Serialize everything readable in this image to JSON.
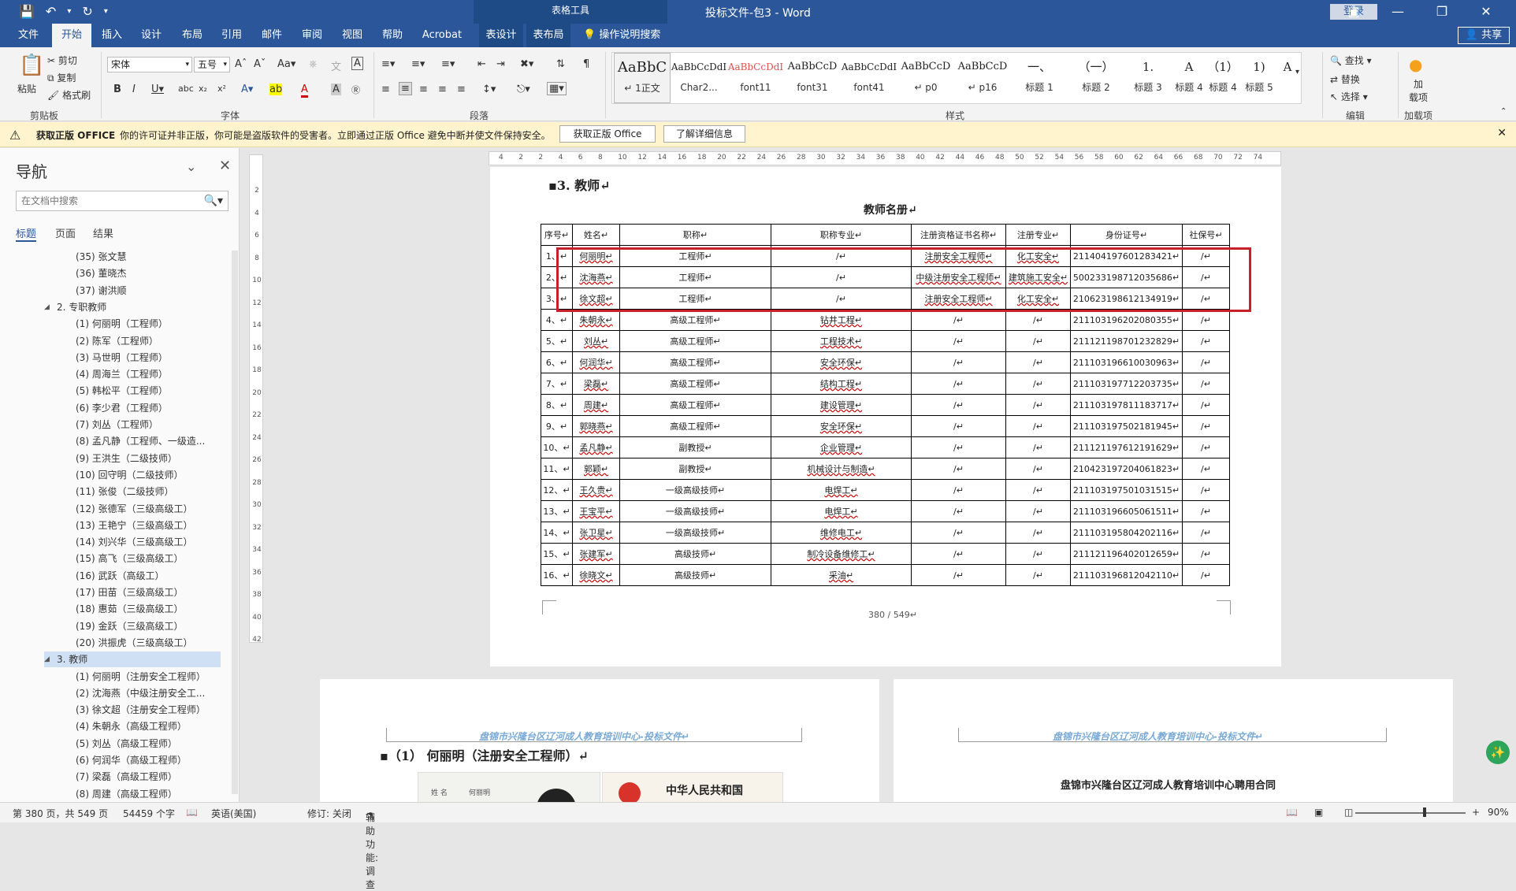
{
  "app": {
    "window_title": "投标文件-包3 - Word",
    "contextual_tab_group": "表格工具",
    "login_label": "登录",
    "share_label": "共享"
  },
  "qat": {
    "save_icon": "save-icon",
    "undo_icon": "undo-icon",
    "redo_icon": "redo-icon",
    "customize_icon": "chevron-down-icon"
  },
  "tabs": [
    {
      "label": "文件"
    },
    {
      "label": "开始"
    },
    {
      "label": "插入"
    },
    {
      "label": "设计"
    },
    {
      "label": "布局"
    },
    {
      "label": "引用"
    },
    {
      "label": "邮件"
    },
    {
      "label": "审阅"
    },
    {
      "label": "视图"
    },
    {
      "label": "帮助"
    },
    {
      "label": "Acrobat"
    },
    {
      "label": "表设计"
    },
    {
      "label": "表布局"
    }
  ],
  "tell_me": "操作说明搜索",
  "ribbon": {
    "clipboard": {
      "paste": "粘贴",
      "cut": "剪切",
      "copy": "复制",
      "format_painter": "格式刷",
      "group_label": "剪贴板"
    },
    "font": {
      "font_name": "宋体",
      "font_size": "五号",
      "group_label": "字体"
    },
    "paragraph": {
      "group_label": "段落"
    },
    "styles": {
      "group_label": "样式",
      "items": [
        {
          "sample": "AaBbC",
          "name": "↵ 1正文"
        },
        {
          "sample": "AaBbCcDdI",
          "name": "Char2..."
        },
        {
          "sample": "AaBbCcDdI",
          "name": "font11"
        },
        {
          "sample": "AaBbCcD",
          "name": "font31"
        },
        {
          "sample": "AaBbCcDdI",
          "name": "font41"
        },
        {
          "sample": "AaBbCcD",
          "name": "↵ p0"
        },
        {
          "sample": "AaBbCcD",
          "name": "↵ p16"
        },
        {
          "sample": "一、",
          "name": "标题 1"
        },
        {
          "sample": "（一）",
          "name": "标题 2"
        },
        {
          "sample": "1.",
          "name": "标题 3"
        },
        {
          "sample": "A",
          "name": "标题 4"
        },
        {
          "sample": "（1）",
          "name": "标题 4"
        },
        {
          "sample": "1)",
          "name": "标题 5"
        },
        {
          "sample": "A",
          "name": ""
        }
      ]
    },
    "editing": {
      "find": "查找",
      "replace": "替换",
      "select": "选择",
      "group_label": "编辑"
    },
    "addins": {
      "label": "加载项",
      "button": "加\n载项"
    }
  },
  "message_bar": {
    "title": "获取正版 OFFICE",
    "text": "你的许可证并非正版，你可能是盗版软件的受害者。立即通过正版 Office 避免中断并使文件保持安全。",
    "btn_genuine": "获取正版 Office",
    "btn_learn": "了解详细信息"
  },
  "nav": {
    "title": "导航",
    "search_placeholder": "在文档中搜索",
    "tabs": [
      "标题",
      "页面",
      "结果"
    ],
    "items": [
      {
        "text": "(35)  张文慧",
        "level": 3
      },
      {
        "text": "(36)  董晓杰",
        "level": 3
      },
      {
        "text": "(37)  谢洪顺",
        "level": 3
      },
      {
        "text": "2. 专职教师",
        "level": 2
      },
      {
        "text": "(1)  何丽明（工程师）",
        "level": 3
      },
      {
        "text": "(2)  陈军（工程师）",
        "level": 3
      },
      {
        "text": "(3)  马世明（工程师）",
        "level": 3
      },
      {
        "text": "(4)  周海兰（工程师）",
        "level": 3
      },
      {
        "text": "(5)  韩松平（工程师）",
        "level": 3
      },
      {
        "text": "(6)  李少君（工程师）",
        "level": 3
      },
      {
        "text": "(7)  刘丛（工程师）",
        "level": 3
      },
      {
        "text": "(8)  孟凡静（工程师、一级造...",
        "level": 3
      },
      {
        "text": "(9)  王洪生（二级技师）",
        "level": 3
      },
      {
        "text": "(10)  回守明（二级技师）",
        "level": 3
      },
      {
        "text": "(11)  张俊（二级技师）",
        "level": 3
      },
      {
        "text": "(12)  张德军（三级高级工）",
        "level": 3
      },
      {
        "text": "(13)  王艳宁（三级高级工）",
        "level": 3
      },
      {
        "text": "(14)  刘兴华（三级高级工）",
        "level": 3
      },
      {
        "text": "(15)  高飞（三级高级工）",
        "level": 3
      },
      {
        "text": "(16)  武跃（高级工）",
        "level": 3
      },
      {
        "text": "(17)  田苗（三级高级工）",
        "level": 3
      },
      {
        "text": "(18)  惠茹（三级高级工）",
        "level": 3
      },
      {
        "text": "(19)  金跃（三级高级工）",
        "level": 3
      },
      {
        "text": "(20)  洪振虎（三级高级工）",
        "level": 3
      },
      {
        "text": "3. 教师",
        "level": 2
      },
      {
        "text": "(1)  何丽明（注册安全工程师）",
        "level": 3
      },
      {
        "text": "(2)  沈海燕（中级注册安全工...",
        "level": 3
      },
      {
        "text": "(3)  徐文超（注册安全工程师）",
        "level": 3
      },
      {
        "text": "(4)  朱朝永（高级工程师）",
        "level": 3
      },
      {
        "text": "(5)  刘丛（高级工程师）",
        "level": 3
      },
      {
        "text": "(6)  何润华（高级工程师）",
        "level": 3
      },
      {
        "text": "(7)  梁磊（高级工程师）",
        "level": 3
      },
      {
        "text": "(8)  周建（高级工程师）",
        "level": 3
      }
    ]
  },
  "ruler": {
    "h_ticks": [
      "4",
      "2",
      "2",
      "4",
      "6",
      "8",
      "10",
      "12",
      "14",
      "16",
      "18",
      "20",
      "22",
      "24",
      "26",
      "28",
      "30",
      "32",
      "34",
      "36",
      "38",
      "40",
      "42",
      "44",
      "46",
      "48",
      "50",
      "52",
      "54",
      "56",
      "58",
      "60",
      "62",
      "64",
      "66",
      "68",
      "70",
      "72",
      "74"
    ],
    "v_ticks": [
      "2",
      "4",
      "6",
      "8",
      "10",
      "12",
      "14",
      "16",
      "18",
      "20",
      "22",
      "24",
      "26",
      "28",
      "30",
      "32",
      "34",
      "36",
      "38",
      "40",
      "42"
    ]
  },
  "document": {
    "section_heading": "▪3.  教师↵",
    "table_caption": "教师名册↵",
    "columns": [
      "序号↵",
      "姓名↵",
      "职称↵",
      "职称专业↵",
      "注册资格证书名称↵",
      "注册专业↵",
      "身份证号↵",
      "社保号↵"
    ],
    "rows": [
      [
        "1、↵",
        "何丽明↵",
        "工程师↵",
        "/↵",
        "注册安全工程师↵",
        "化工安全↵",
        "211404197601283421↵",
        "/↵"
      ],
      [
        "2、↵",
        "沈海燕↵",
        "工程师↵",
        "/↵",
        "中级注册安全工程师↵",
        "建筑施工安全↵",
        "500233198712035686↵",
        "/↵"
      ],
      [
        "3、↵",
        "徐文超↵",
        "工程师↵",
        "/↵",
        "注册安全工程师↵",
        "化工安全↵",
        "210623198612134919↵",
        "/↵"
      ],
      [
        "4、↵",
        "朱朝永↵",
        "高级工程师↵",
        "钻井工程↵",
        "/↵",
        "/↵",
        "211103196202080355↵",
        "/↵"
      ],
      [
        "5、↵",
        "刘丛↵",
        "高级工程师↵",
        "工程技术↵",
        "/↵",
        "/↵",
        "211121198701232829↵",
        "/↵"
      ],
      [
        "6、↵",
        "何润华↵",
        "高级工程师↵",
        "安全环保↵",
        "/↵",
        "/↵",
        "211103196610030963↵",
        "/↵"
      ],
      [
        "7、↵",
        "梁磊↵",
        "高级工程师↵",
        "结构工程↵",
        "/↵",
        "/↵",
        "211103197712203735↵",
        "/↵"
      ],
      [
        "8、↵",
        "周建↵",
        "高级工程师↵",
        "建设管理↵",
        "/↵",
        "/↵",
        "211103197811183717↵",
        "/↵"
      ],
      [
        "9、↵",
        "郭晓燕↵",
        "高级工程师↵",
        "安全环保↵",
        "/↵",
        "/↵",
        "211103197502181945↵",
        "/↵"
      ],
      [
        "10、↵",
        "孟凡静↵",
        "副教授↵",
        "企业管理↵",
        "/↵",
        "/↵",
        "211121197612191629↵",
        "/↵"
      ],
      [
        "11、↵",
        "郭颖↵",
        "副教授↵",
        "机械设计与制造↵",
        "/↵",
        "/↵",
        "210423197204061823↵",
        "/↵"
      ],
      [
        "12、↵",
        "王久贵↵",
        "一级高级技师↵",
        "电焊工↵",
        "/↵",
        "/↵",
        "211103197501031515↵",
        "/↵"
      ],
      [
        "13、↵",
        "王宝平↵",
        "一级高级技师↵",
        "电焊工↵",
        "/↵",
        "/↵",
        "211103196605061511↵",
        "/↵"
      ],
      [
        "14、↵",
        "张卫星↵",
        "一级高级技师↵",
        "维修电工↵",
        "/↵",
        "/↵",
        "211103195804202116↵",
        "/↵"
      ],
      [
        "15、↵",
        "张建军↵",
        "高级技师↵",
        "制冷设备维修工↵",
        "/↵",
        "/↵",
        "211121196402012659↵",
        "/↵"
      ],
      [
        "16、↵",
        "徐晓文↵",
        "高级技师↵",
        "采油↵",
        "/↵",
        "/↵",
        "211103196812042110↵",
        "/↵"
      ]
    ],
    "page_number": "380  /  549↵",
    "header_text": "盘锦市兴隆台区辽河成人教育培训中心-投标文件↵",
    "page2_heading": "▪（1）  何丽明（注册安全工程师）↵",
    "contract_title": "盘锦市兴隆台区辽河成人教育培训中心聘用合同",
    "cert_name_label": "姓  名",
    "cert_name_value": "何丽明",
    "cert_title": "中华人民共和国"
  },
  "status": {
    "page": "第 380 页，共 549 页",
    "words": "54459 个字",
    "lang": "英语(美国)",
    "track": "修订: 关闭",
    "access": "辅助功能: 调查",
    "zoom": "90%"
  },
  "colors": {
    "word_blue": "#2b579a",
    "highlight_red": "#c5202c",
    "msgbar_bg": "#fff4ce"
  }
}
